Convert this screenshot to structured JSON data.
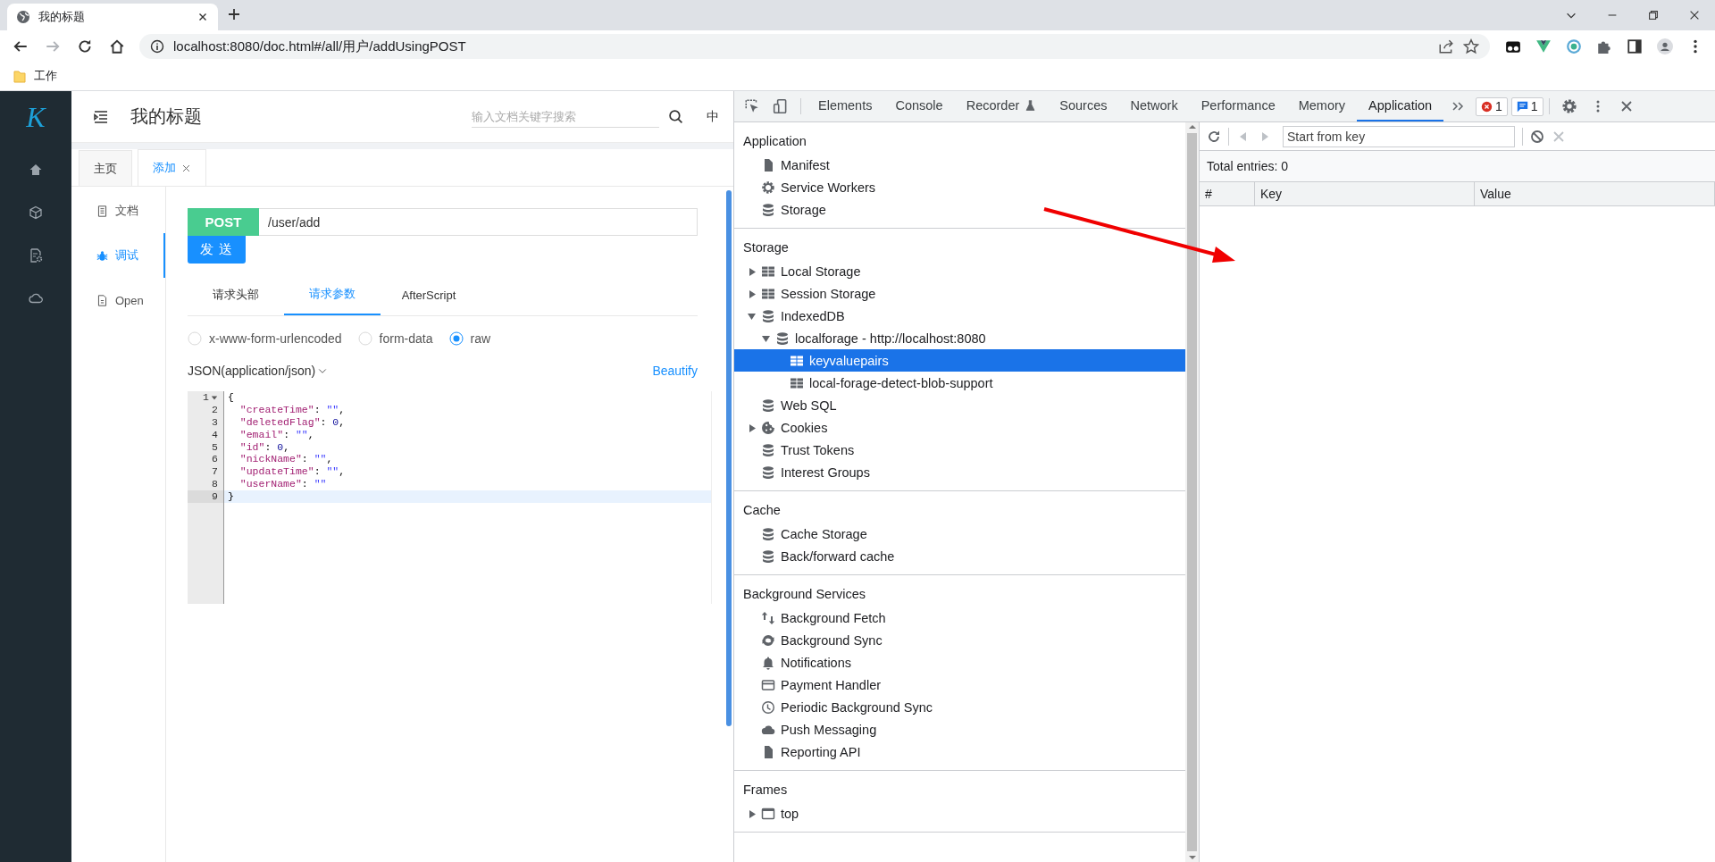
{
  "browser": {
    "tab_title": "我的标题",
    "url": "localhost:8080/doc.html#/all/用户/addUsingPOST",
    "bookmarks": [
      "工作"
    ]
  },
  "app": {
    "logo": "K",
    "title": "我的标题",
    "search": {
      "placeholder": "输入文档关键字搜索"
    },
    "language": "中",
    "tabs": [
      {
        "label": "主页",
        "selected": false,
        "closable": false
      },
      {
        "label": "添加",
        "selected": true,
        "closable": true
      }
    ],
    "side_menu": [
      {
        "label": "文档",
        "kind": "doc",
        "selected": false
      },
      {
        "label": "调试",
        "kind": "bug",
        "selected": true
      },
      {
        "label": "Open",
        "kind": "file",
        "selected": false
      }
    ],
    "method": "POST",
    "path": "/user/add",
    "send_button": "发 送",
    "param_tabs": [
      {
        "label": "请求头部",
        "selected": false
      },
      {
        "label": "请求参数",
        "selected": true
      },
      {
        "label": "AfterScript",
        "selected": false
      }
    ],
    "body_types": [
      {
        "label": "x-www-form-urlencoded",
        "selected": false
      },
      {
        "label": "form-data",
        "selected": false
      },
      {
        "label": "raw",
        "selected": true
      }
    ],
    "content_type": "JSON(application/json)",
    "beautify": "Beautify",
    "code": [
      {
        "number": "1",
        "text": "{",
        "foldable": true,
        "current": false
      },
      {
        "number": "2",
        "text": "  \"createTime\": \"\",",
        "foldable": false,
        "current": false
      },
      {
        "number": "3",
        "text": "  \"deletedFlag\": 0,",
        "foldable": false,
        "current": false
      },
      {
        "number": "4",
        "text": "  \"email\": \"\",",
        "foldable": false,
        "current": false
      },
      {
        "number": "5",
        "text": "  \"id\": 0,",
        "foldable": false,
        "current": false
      },
      {
        "number": "6",
        "text": "  \"nickName\": \"\",",
        "foldable": false,
        "current": false
      },
      {
        "number": "7",
        "text": "  \"updateTime\": \"\",",
        "foldable": false,
        "current": false
      },
      {
        "number": "8",
        "text": "  \"userName\": \"\"",
        "foldable": false,
        "current": false
      },
      {
        "number": "9",
        "text": "}",
        "foldable": false,
        "current": true
      }
    ]
  },
  "devtools": {
    "tabs": [
      {
        "label": "Elements",
        "selected": false
      },
      {
        "label": "Console",
        "selected": false
      },
      {
        "label": "Recorder",
        "selected": false
      },
      {
        "label": "Sources",
        "selected": false
      },
      {
        "label": "Network",
        "selected": false
      },
      {
        "label": "Performance",
        "selected": false
      },
      {
        "label": "Memory",
        "selected": false
      },
      {
        "label": "Application",
        "selected": true
      }
    ],
    "errors": "1",
    "messages": "1",
    "sections": [
      {
        "title": "Application",
        "items": [
          {
            "label": "Manifest",
            "kind": "file",
            "selected": false
          },
          {
            "label": "Service Workers",
            "kind": "gear",
            "selected": false
          },
          {
            "label": "Storage",
            "kind": "database",
            "selected": false
          }
        ]
      },
      {
        "title": "Storage",
        "items": [
          {
            "label": "Local Storage",
            "kind": "table",
            "expanded": false,
            "selected": false
          },
          {
            "label": "Session Storage",
            "kind": "table",
            "expanded": false,
            "selected": false
          },
          {
            "label": "IndexedDB",
            "kind": "database",
            "expanded": true,
            "selected": false,
            "children": [
              {
                "label": "localforage - http://localhost:8080",
                "kind": "database",
                "expanded": true,
                "selected": false,
                "children": [
                  {
                    "label": "keyvaluepairs",
                    "kind": "table",
                    "selected": true
                  },
                  {
                    "label": "local-forage-detect-blob-support",
                    "kind": "table",
                    "selected": false
                  }
                ]
              }
            ]
          },
          {
            "label": "Web SQL",
            "kind": "database",
            "selected": false
          },
          {
            "label": "Cookies",
            "kind": "cookie",
            "expanded": false,
            "selected": false
          },
          {
            "label": "Trust Tokens",
            "kind": "database",
            "selected": false
          },
          {
            "label": "Interest Groups",
            "kind": "database",
            "selected": false
          }
        ]
      },
      {
        "title": "Cache",
        "items": [
          {
            "label": "Cache Storage",
            "kind": "database",
            "selected": false
          },
          {
            "label": "Back/forward cache",
            "kind": "database",
            "selected": false
          }
        ]
      },
      {
        "title": "Background Services",
        "items": [
          {
            "label": "Background Fetch",
            "kind": "updown",
            "selected": false
          },
          {
            "label": "Background Sync",
            "kind": "sync",
            "selected": false
          },
          {
            "label": "Notifications",
            "kind": "bell",
            "selected": false
          },
          {
            "label": "Payment Handler",
            "kind": "card",
            "selected": false
          },
          {
            "label": "Periodic Background Sync",
            "kind": "clock",
            "selected": false
          },
          {
            "label": "Push Messaging",
            "kind": "cloud",
            "selected": false
          },
          {
            "label": "Reporting API",
            "kind": "file",
            "selected": false
          }
        ]
      },
      {
        "title": "Frames",
        "items": [
          {
            "label": "top",
            "kind": "frame",
            "expanded": false,
            "selected": false
          }
        ]
      }
    ],
    "storage_view": {
      "filter": {
        "placeholder": "Start from key"
      },
      "total": "Total entries: 0",
      "columns": [
        "#",
        "Key",
        "Value"
      ]
    }
  }
}
